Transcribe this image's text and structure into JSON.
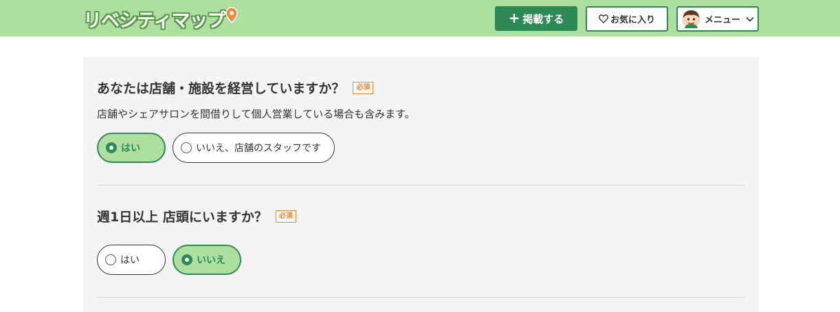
{
  "header": {
    "logo_text": "リベシティマップ",
    "post_button": "掲載する",
    "post_icon": "+",
    "favorites_button": "お気に入り",
    "menu_button": "メニュー"
  },
  "questions": [
    {
      "title": "あなたは店舗・施設を経営していますか？",
      "badge": "必須",
      "description": "店舗やシェアサロンを間借りして個人営業している場合も含みます。",
      "options": [
        {
          "label": "はい",
          "selected": true
        },
        {
          "label": "いいえ、店舗のスタッフです",
          "selected": false
        }
      ]
    },
    {
      "title": "週1日以上 店頭にいますか？",
      "badge": "必須",
      "options": [
        {
          "label": "はい",
          "selected": false
        },
        {
          "label": "いいえ",
          "selected": true
        }
      ]
    }
  ],
  "colors": {
    "header_bg": "#acdfa0",
    "primary": "#2e8a55",
    "required": "#e8883a",
    "panel_bg": "#f4f4f4"
  }
}
